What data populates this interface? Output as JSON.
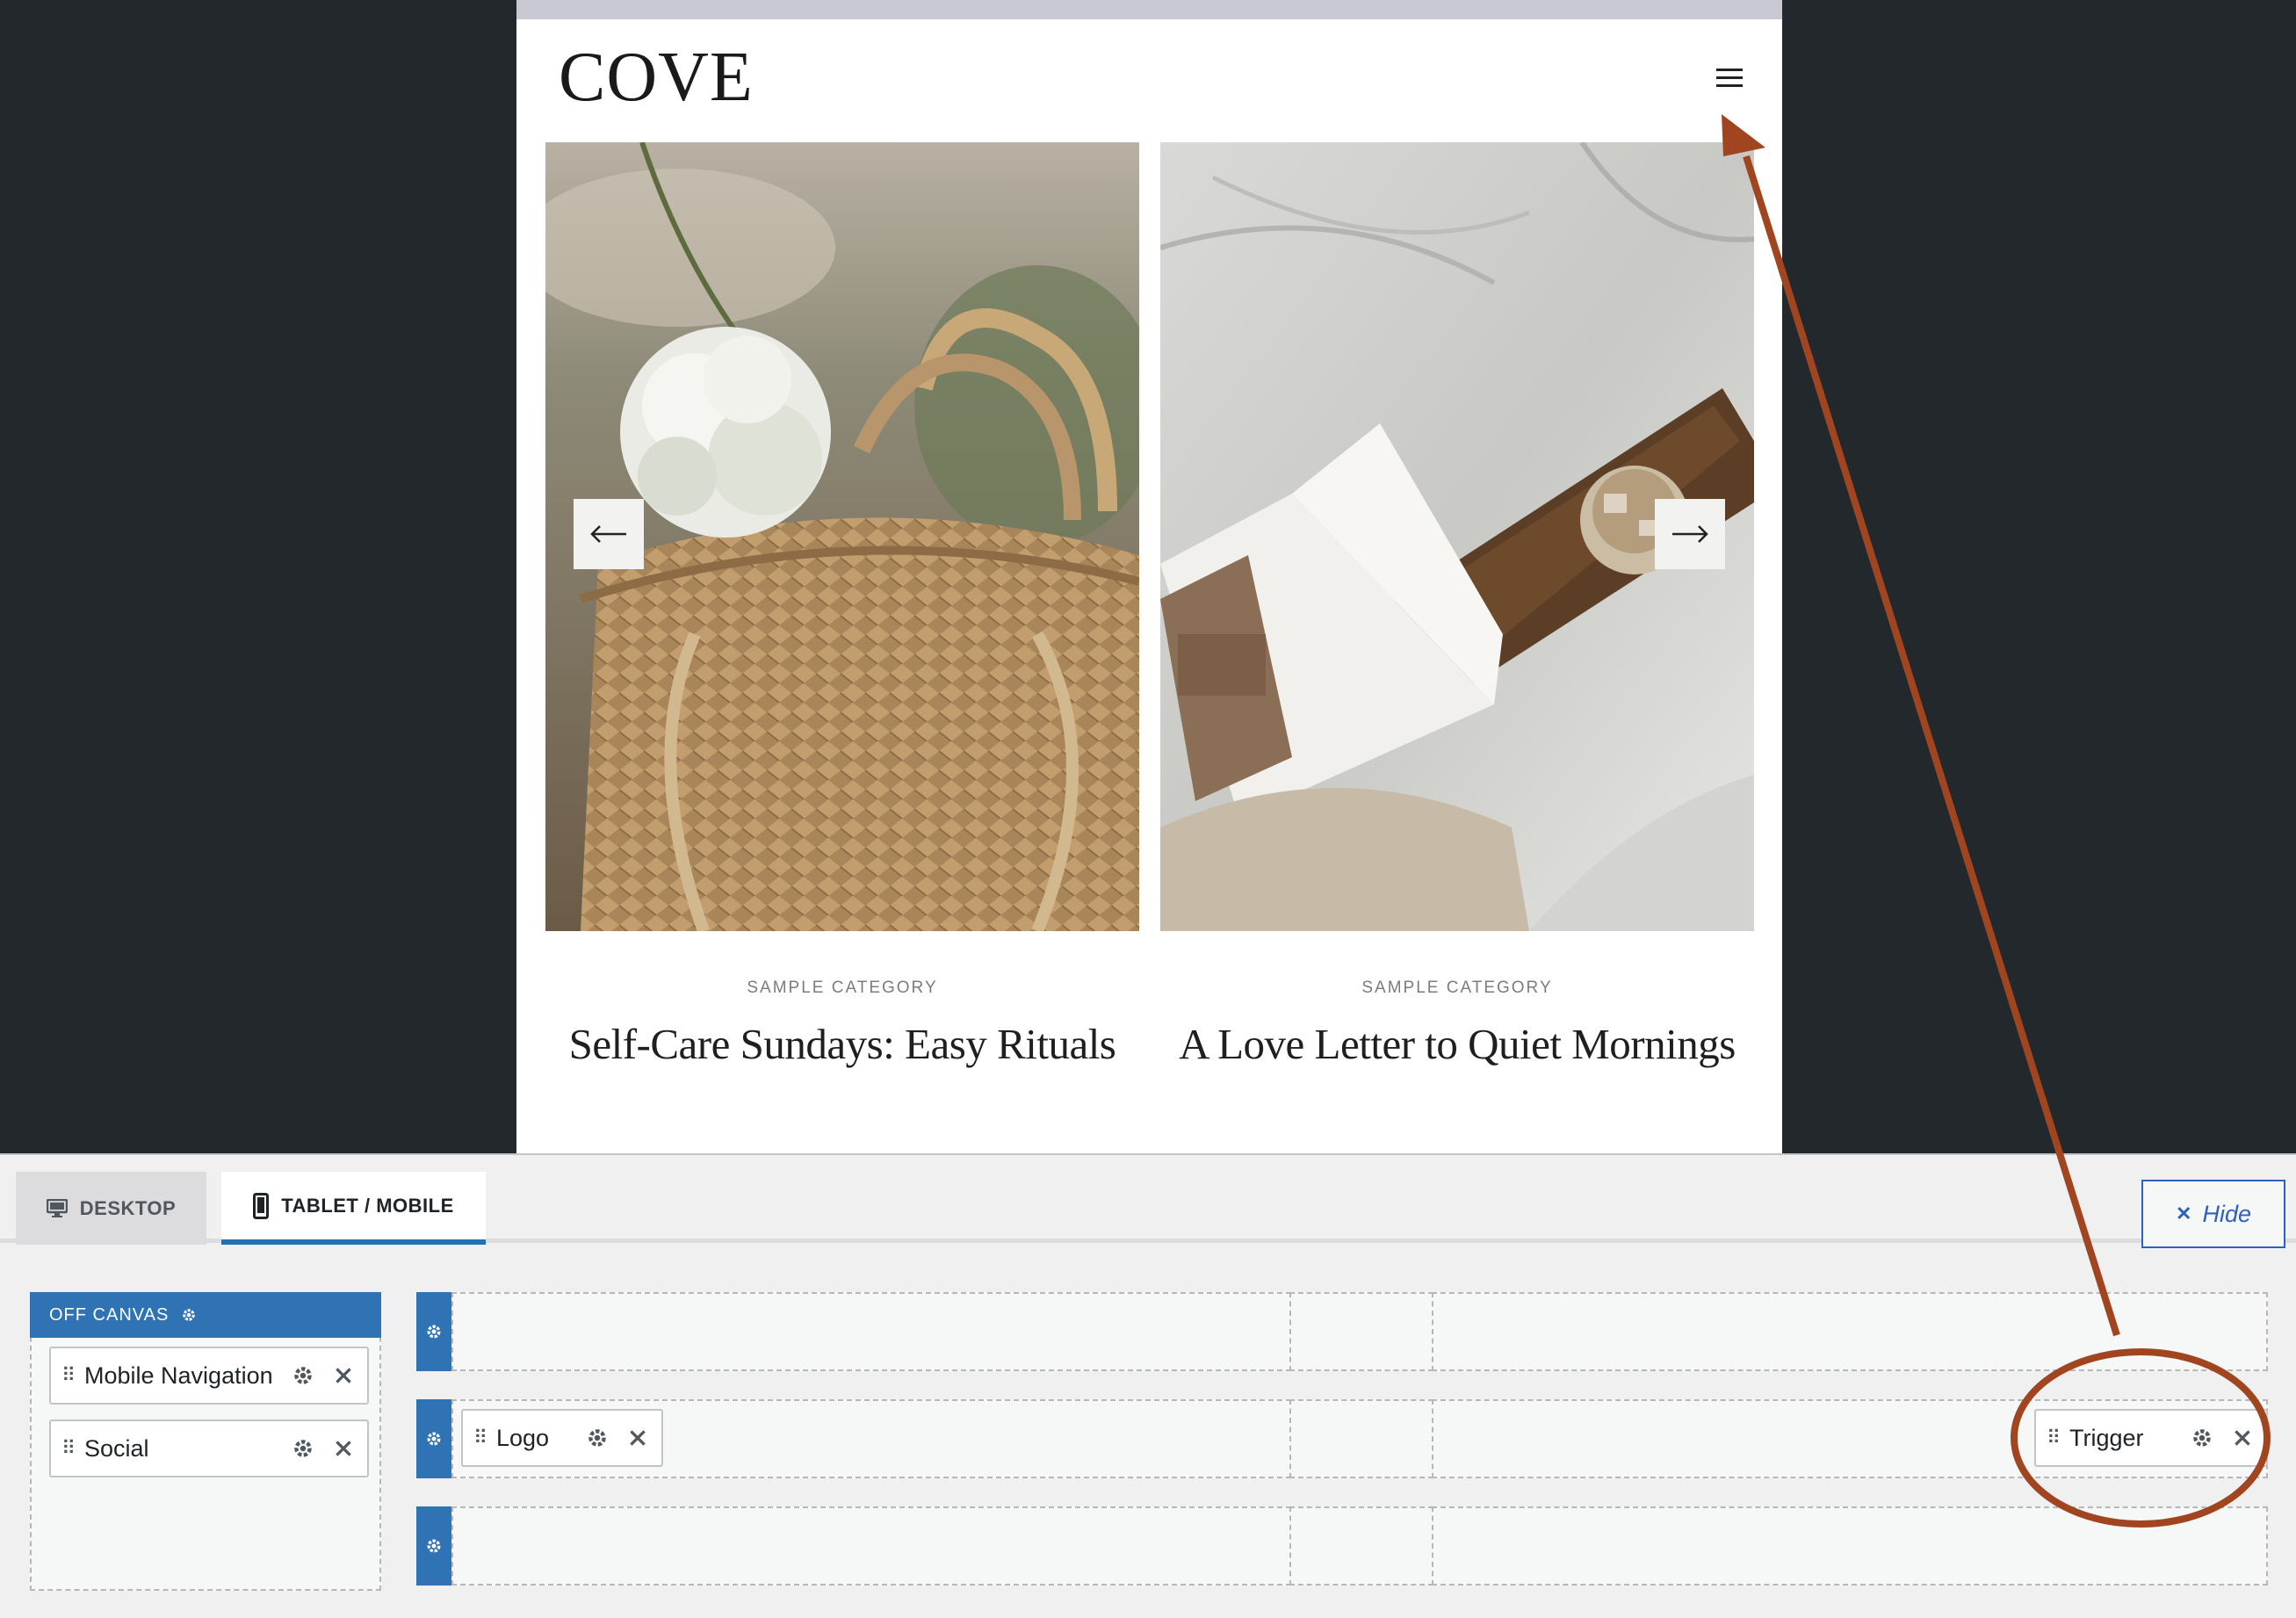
{
  "site": {
    "logo": "COVE",
    "posts": [
      {
        "category": "SAMPLE CATEGORY",
        "title": "Self-Care Sundays: Easy Rituals"
      },
      {
        "category": "SAMPLE CATEGORY",
        "title": "A Love Letter to Quiet Mornings"
      }
    ]
  },
  "builder": {
    "tabs": [
      {
        "label": "DESKTOP",
        "icon": "desktop-icon",
        "active": false
      },
      {
        "label": "TABLET / MOBILE",
        "icon": "mobile-icon",
        "active": true
      }
    ],
    "hide_label": "Hide",
    "off_canvas": {
      "title": "OFF CANVAS",
      "items": [
        {
          "label": "Mobile Navigation"
        },
        {
          "label": "Social"
        }
      ]
    },
    "rows": {
      "main_left_item": "Logo",
      "main_right_item": "Trigger"
    }
  },
  "colors": {
    "accent": "#2f73b5",
    "annotation": "#a0451f",
    "backdrop": "#23282d"
  }
}
